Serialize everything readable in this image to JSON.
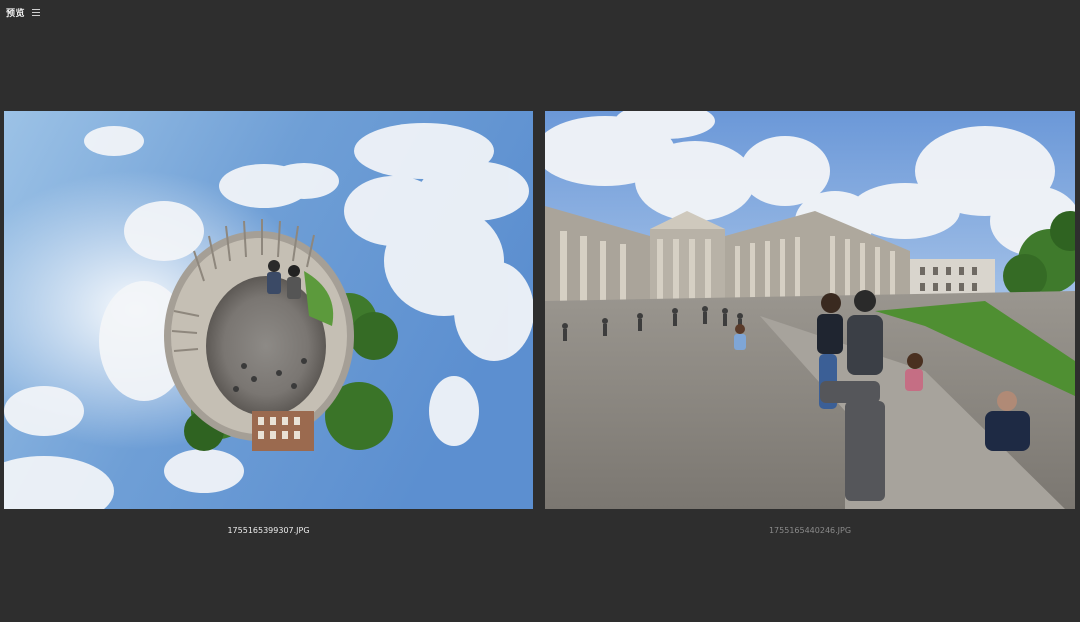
{
  "app": {
    "title": "预览"
  },
  "icons": {
    "menu": "hamburger-menu-icon"
  },
  "images": [
    {
      "filename": "1755165399307.JPG",
      "selected": true,
      "description_type": "tiny-planet panorama"
    },
    {
      "filename": "1755165440246.JPG",
      "selected": false,
      "description_type": "wide-angle photo"
    }
  ],
  "colors": {
    "background": "#2e2e2e",
    "filename_selected": "#ececec",
    "filename_unselected": "#8a8a8a"
  }
}
